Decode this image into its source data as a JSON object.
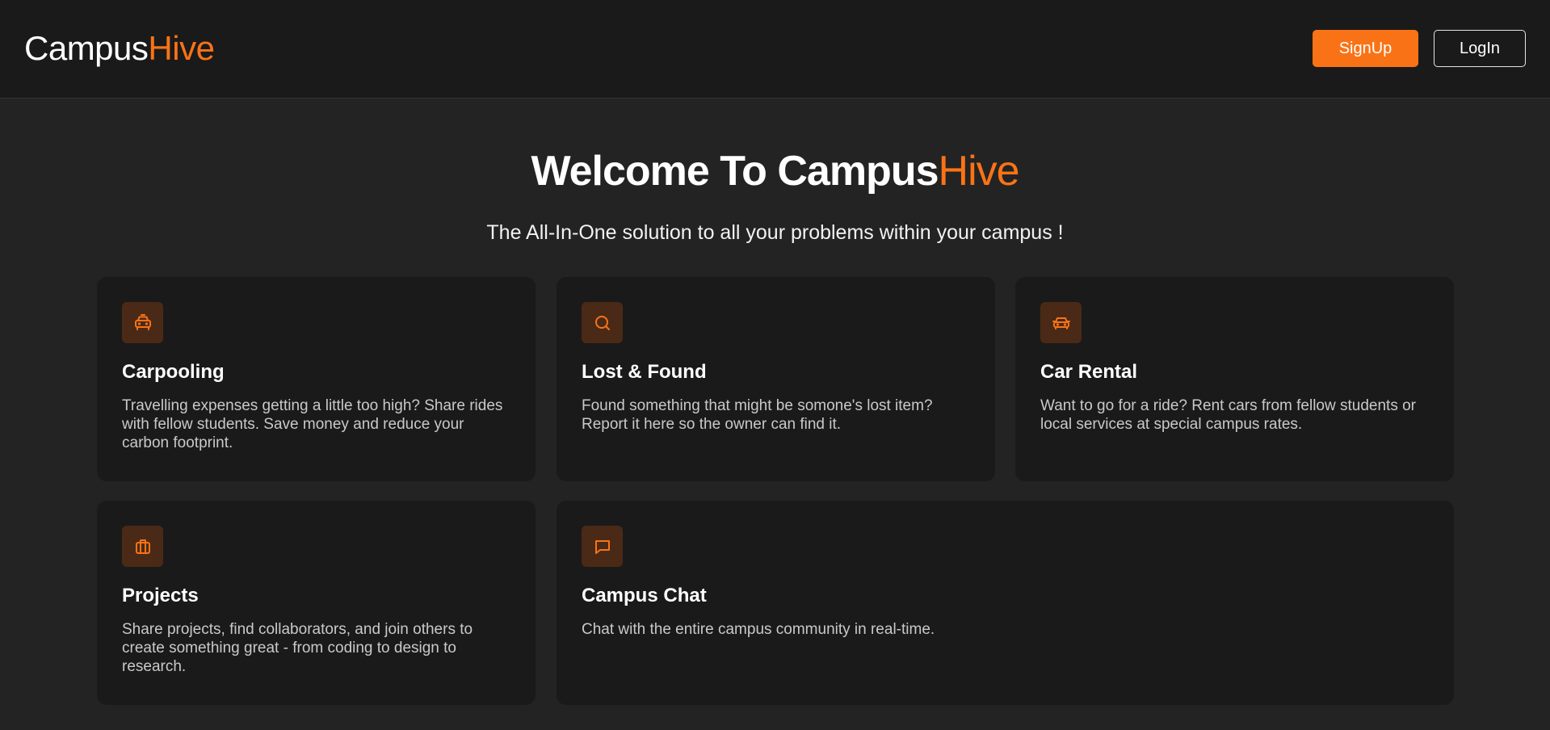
{
  "navbar": {
    "logo_main": "Campus",
    "logo_accent": "Hive",
    "signup_label": "SignUp",
    "login_label": "LogIn"
  },
  "hero": {
    "title_main": "Welcome To Campus",
    "title_accent": "Hive",
    "subtitle": "The All-In-One solution to all your problems within your campus !"
  },
  "features": [
    {
      "icon": "taxi-icon",
      "title": "Carpooling",
      "description": "Travelling expenses getting a little too high? Share rides with fellow students. Save money and reduce your carbon footprint."
    },
    {
      "icon": "search-icon",
      "title": "Lost & Found",
      "description": "Found something that might be somone's lost item? Report it here so the owner can find it."
    },
    {
      "icon": "car-icon",
      "title": "Car Rental",
      "description": "Want to go for a ride? Rent cars from fellow students or local services at special campus rates."
    },
    {
      "icon": "briefcase-icon",
      "title": "Projects",
      "description": "Share projects, find collaborators, and join others to create something great - from coding to design to research."
    },
    {
      "icon": "chat-icon",
      "title": "Campus Chat",
      "description": "Chat with the entire campus community in real-time."
    }
  ],
  "colors": {
    "accent": "#f97316",
    "background": "#232323",
    "navbar": "#1a1a1a",
    "card": "#1a1a1a",
    "icon_bg": "#4a2a16"
  }
}
